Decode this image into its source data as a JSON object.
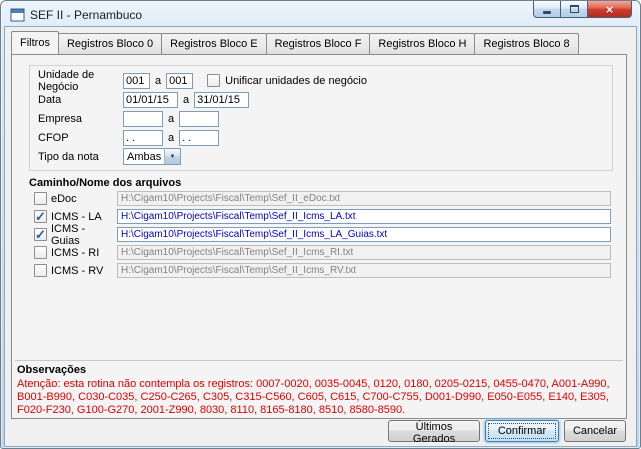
{
  "window": {
    "title": "SEF II - Pernambuco"
  },
  "tabs": [
    {
      "label": "Filtros"
    },
    {
      "label": "Registros Bloco 0"
    },
    {
      "label": "Registros Bloco E"
    },
    {
      "label": "Registros Bloco F"
    },
    {
      "label": "Registros Bloco H"
    },
    {
      "label": "Registros Bloco 8"
    }
  ],
  "filters": {
    "unidade_label": "Unidade de Negócio",
    "unidade_from": "001",
    "unidade_to": "001",
    "range_sep": "a",
    "unificar_label": "Unificar unidades de negócio",
    "unificar_checked": false,
    "data_label": "Data",
    "data_from": "01/01/15",
    "data_to": "31/01/15",
    "empresa_label": "Empresa",
    "empresa_from": "",
    "empresa_to": "",
    "cfop_label": "CFOP",
    "cfop_from": ". .",
    "cfop_to": ". .",
    "tipo_label": "Tipo da nota",
    "tipo_value": "Ambas"
  },
  "files": {
    "section_title": "Caminho/Nome dos arquivos",
    "rows": [
      {
        "label": "eDoc",
        "checked": false,
        "enabled": false,
        "path": "H:\\Cigam10\\Projects\\Fiscal\\Temp\\Sef_II_eDoc.txt"
      },
      {
        "label": "ICMS - LA",
        "checked": true,
        "enabled": true,
        "path": "H:\\Cigam10\\Projects\\Fiscal\\Temp\\Sef_II_Icms_LA.txt"
      },
      {
        "label": "ICMS - Guias",
        "checked": true,
        "enabled": true,
        "path": "H:\\Cigam10\\Projects\\Fiscal\\Temp\\Sef_II_Icms_LA_Guias.txt"
      },
      {
        "label": "ICMS - RI",
        "checked": false,
        "enabled": false,
        "path": "H:\\Cigam10\\Projects\\Fiscal\\Temp\\Sef_II_Icms_RI.txt"
      },
      {
        "label": "ICMS - RV",
        "checked": false,
        "enabled": false,
        "path": "H:\\Cigam10\\Projects\\Fiscal\\Temp\\Sef_II_Icms_RV.txt"
      }
    ]
  },
  "observacoes": {
    "title": "Observações",
    "warning": "Atenção: esta rotina não contempla os registros: 0007-0020, 0035-0045, 0120, 0180, 0205-0215, 0455-0470, A001-A990, B001-B990, C030-C035, C250-C265, C305, C315-C560, C605, C615, C700-C755, D001-D990, E050-E055, E140, E305, F020-F230, G100-G270, 2001-Z990, 8030, 8110, 8165-8180, 8510, 8580-8590."
  },
  "footer": {
    "ultimos_label": "Últimos Gerados",
    "confirmar_label": "Confirmar",
    "cancelar_label": "Cancelar"
  },
  "colors": {
    "warning_text": "#E00000",
    "enabled_path_text": "#0000CC",
    "close_button_red": "#CC3B2D",
    "titlebar_blue": "#CADCEE"
  }
}
